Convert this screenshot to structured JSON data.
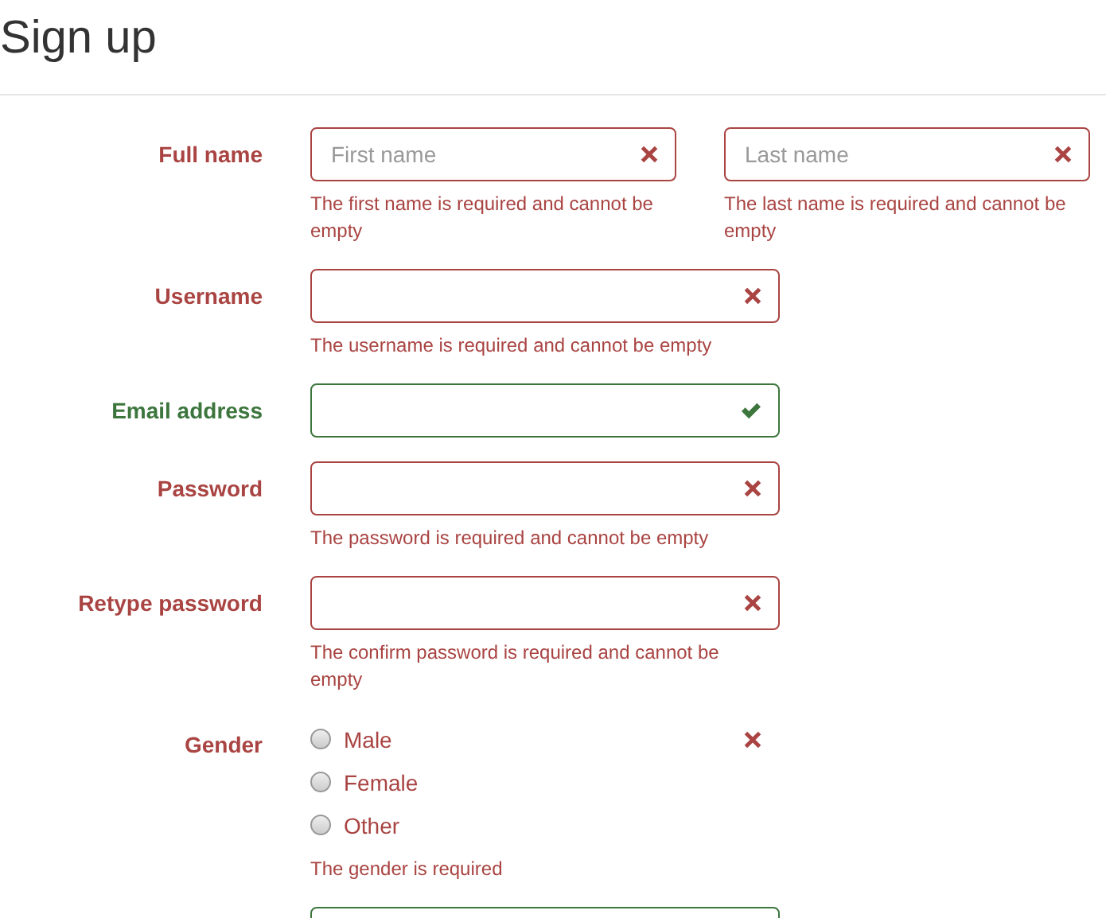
{
  "title": "Sign up",
  "rows": [
    {
      "kind": "pair",
      "label": "Full name",
      "fields": [
        {
          "placeholder": "First name",
          "valid": false,
          "error": "The first name is required and cannot be empty"
        },
        {
          "placeholder": "Last name",
          "valid": false,
          "error": "The last name is required and cannot be empty"
        }
      ]
    },
    {
      "kind": "text",
      "label": "Username",
      "fields": [
        {
          "valid": false,
          "error": "The username is required and cannot be empty"
        }
      ]
    },
    {
      "kind": "text",
      "label": "Email address",
      "fields": [
        {
          "valid": true
        }
      ]
    },
    {
      "kind": "text",
      "label": "Password",
      "fields": [
        {
          "valid": false,
          "error": "The password is required and cannot be empty"
        }
      ]
    },
    {
      "kind": "text",
      "label": "Retype password",
      "fields": [
        {
          "valid": false,
          "error": "The confirm password is required and cannot be empty"
        }
      ]
    },
    {
      "kind": "radio",
      "label": "Gender",
      "valid": false,
      "options": [
        {
          "label": "Male",
          "selected": false
        },
        {
          "label": "Female",
          "selected": false
        },
        {
          "label": "Other",
          "selected": false
        }
      ],
      "error": "The gender is required"
    },
    {
      "kind": "cut",
      "fields": [
        {
          "valid": true
        }
      ]
    }
  ]
}
